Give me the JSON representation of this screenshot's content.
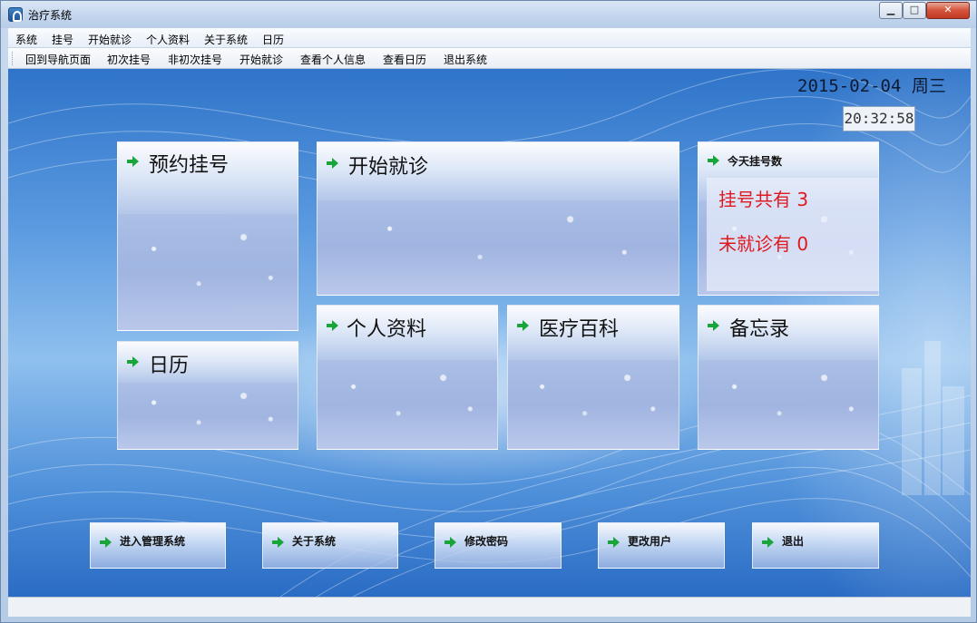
{
  "window": {
    "title": "治疗系统",
    "min_glyph": "▁",
    "max_glyph": "□",
    "close_glyph": "✕"
  },
  "menubar": {
    "items": [
      "系统",
      "挂号",
      "开始就诊",
      "个人资料",
      "关于系统",
      "日历"
    ]
  },
  "toolbar": {
    "items": [
      "回到导航页面",
      "初次挂号",
      "非初次挂号",
      "开始就诊",
      "查看个人信息",
      "查看日历",
      "退出系统"
    ]
  },
  "header": {
    "date": "2015-02-04 周三",
    "clock": "20:32:58"
  },
  "tiles": {
    "appointment": "预约挂号",
    "start_consult": "开始就诊",
    "today_count_title": "今天挂号数",
    "calendar": "日历",
    "profile": "个人资料",
    "encyclopedia": "医疗百科",
    "memo": "备忘录"
  },
  "stats": {
    "registered": "挂号共有 3",
    "not_seen": "未就诊有 0"
  },
  "bottom_buttons": [
    "进入管理系统",
    "关于系统",
    "修改密码",
    "更改用户",
    "退出"
  ],
  "colors": {
    "stat_red": "#e0191e",
    "arrow_green": "#1aa53a"
  },
  "icons": {
    "app": "app-icon",
    "tile_arrow": "green-arrow-icon"
  }
}
